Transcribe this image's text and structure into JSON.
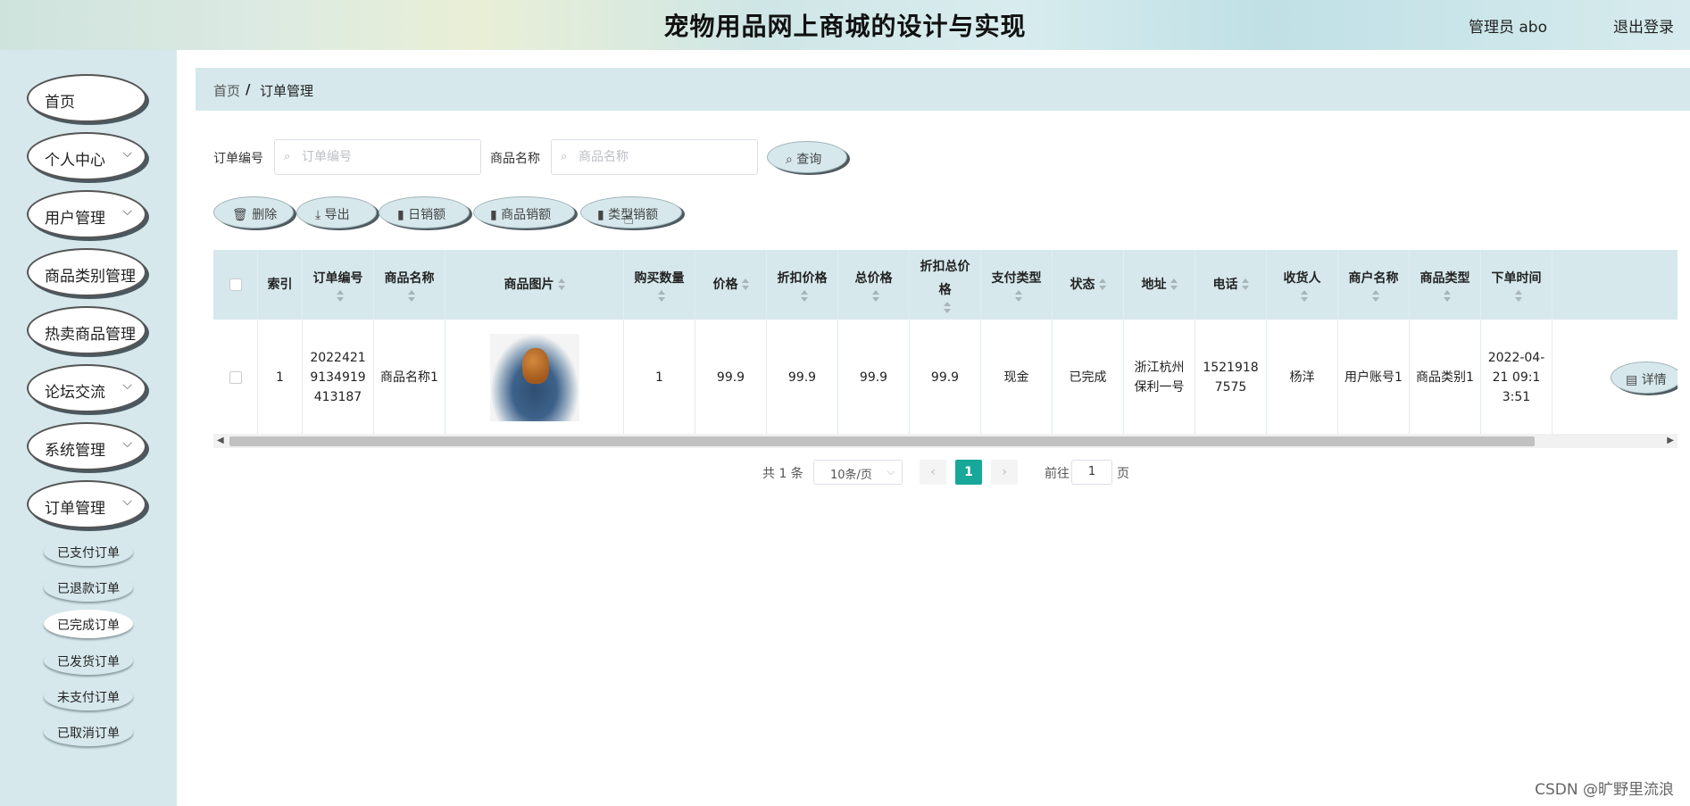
{
  "header": {
    "title": "宠物用品网上商城的设计与实现",
    "user": "管理员 abo",
    "logout": "退出登录"
  },
  "sidebar": {
    "items": [
      {
        "label": "首页",
        "has_children": false
      },
      {
        "label": "个人中心",
        "has_children": true
      },
      {
        "label": "用户管理",
        "has_children": true
      },
      {
        "label": "商品类别管理",
        "has_children": false
      },
      {
        "label": "热卖商品管理",
        "has_children": false
      },
      {
        "label": "论坛交流",
        "has_children": true
      },
      {
        "label": "系统管理",
        "has_children": true
      },
      {
        "label": "订单管理",
        "has_children": true
      }
    ],
    "subitems": [
      {
        "label": "已支付订单",
        "active": false
      },
      {
        "label": "已退款订单",
        "active": false
      },
      {
        "label": "已完成订单",
        "active": true
      },
      {
        "label": "已发货订单",
        "active": false
      },
      {
        "label": "未支付订单",
        "active": false
      },
      {
        "label": "已取消订单",
        "active": false
      }
    ]
  },
  "breadcrumb": {
    "home": "首页",
    "sep": "/",
    "current": "订单管理"
  },
  "search": {
    "order_no_label": "订单编号",
    "order_no_placeholder": "订单编号",
    "product_label": "商品名称",
    "product_placeholder": "商品名称",
    "query_button": "查询"
  },
  "actions": {
    "delete": "删除",
    "export": "导出",
    "daily_sales": "日销额",
    "product_sales": "商品销额",
    "category_sales": "类型销额"
  },
  "table": {
    "headers": {
      "index": "索引",
      "order_no": "订单编号",
      "product_name": "商品名称",
      "product_image": "商品图片",
      "quantity": "购买数量",
      "price": "价格",
      "discount_price": "折扣价格",
      "total_price": "总价格",
      "discount_total": "折扣总价格",
      "pay_type": "支付类型",
      "status": "状态",
      "address": "地址",
      "phone": "电话",
      "receiver": "收货人",
      "merchant": "商户名称",
      "product_type": "商品类型",
      "order_time": "下单时间"
    },
    "rows": [
      {
        "index": "1",
        "order_no": "20224219134919413187",
        "product_name": "商品名称1",
        "quantity": "1",
        "price": "99.9",
        "discount_price": "99.9",
        "total_price": "99.9",
        "discount_total": "99.9",
        "pay_type": "现金",
        "status": "已完成",
        "address": "浙江杭州保利一号",
        "phone": "15219187575",
        "receiver": "杨洋",
        "merchant": "用户账号1",
        "product_type": "商品类别1",
        "order_time": "2022-04-21 09:13:51",
        "detail_button": "详情"
      }
    ]
  },
  "pagination": {
    "total": "共 1 条",
    "page_size": "10条/页",
    "current": "1",
    "goto_label": "前往",
    "goto_value": "1",
    "page_unit": "页"
  },
  "watermark": "CSDN @旷野里流浪"
}
